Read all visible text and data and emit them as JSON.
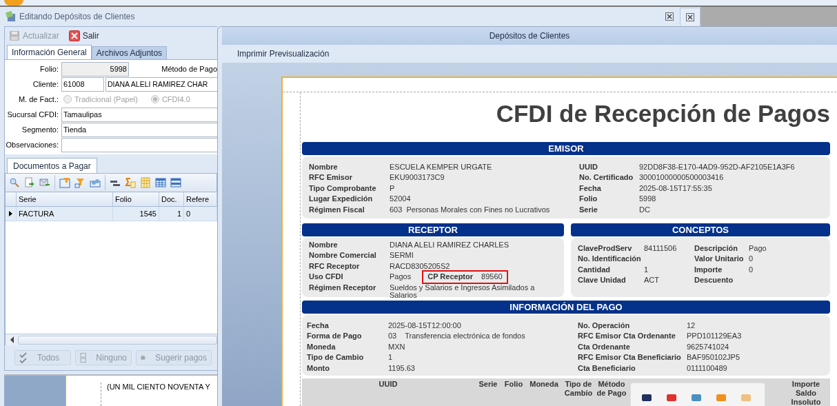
{
  "window": {
    "title": "Editando Depósitos de Clientes"
  },
  "toolbar": [
    {
      "label": "Actualizar",
      "disabled": true,
      "kind": "save"
    },
    {
      "label": "Salir",
      "disabled": false,
      "kind": "exit"
    }
  ],
  "tabs": [
    {
      "label": "Información General",
      "selected": true
    },
    {
      "label": "Archivos Adjuntos",
      "selected": false
    }
  ],
  "form": {
    "folio_label": "Folio:",
    "folio": "5998",
    "metodo_label": "Método de Pago",
    "cliente_label": "Cliente:",
    "cliente_code": "61008",
    "cliente_name": "DIANA ALELI RAMIREZ CHAR",
    "fact_label": "M. de Fact.:",
    "fact_options": [
      {
        "label": "Tradicional (Papel)",
        "selected": false,
        "disabled": true
      },
      {
        "label": "CFDI4.0",
        "selected": true,
        "disabled": true
      }
    ],
    "sucursal_label": "Sucursal CFDI:",
    "sucursal": "Tamaulipas",
    "segmento_label": "Segmento:",
    "segmento": "Tienda",
    "observaciones_label": "Observaciones:"
  },
  "documents": {
    "tab": "Documentos a Pagar",
    "columns": [
      "Serie",
      "Folio",
      "Doc.",
      "Refere"
    ],
    "rows": [
      {
        "selected": true,
        "cells": [
          "FACTURA",
          "1545",
          "1",
          "0"
        ]
      }
    ],
    "buttons": [
      {
        "label": "Todos",
        "disabled": true,
        "kind": "all"
      },
      {
        "label": "Ninguno",
        "disabled": true,
        "kind": "none"
      },
      {
        "label": "Sugerir pagos",
        "disabled": true,
        "kind": "suggest"
      }
    ]
  },
  "behind_text": "(UN MIL CIENTO NOVENTA Y",
  "preview": {
    "title": "Depósitos de Clientes",
    "menu": "Imprimir Previsualización",
    "report": {
      "heading": "CFDI de Recepción de Pagos",
      "emisor": {
        "title": "EMISOR",
        "left": [
          {
            "label": "Nombre",
            "value": "ESCUELA KEMPER URGATE"
          },
          {
            "label": "RFC Emisor",
            "value": "EKU9003173C9"
          },
          {
            "label": "Tipo Comprobante",
            "value": "P"
          },
          {
            "label": "Lugar Expedición",
            "value": "52004"
          },
          {
            "label": "Régimen Fiscal",
            "value": "603  Personas Morales con Fines no Lucrativos"
          }
        ],
        "right": [
          {
            "label": "UUID",
            "value": "92DD8F38-E170-4AD9-952D-AF2105E1A3F6"
          },
          {
            "label": "No. Certificado",
            "value": "30001000000500003416"
          },
          {
            "label": "Fecha",
            "value": "2025-08-15T17:55:35"
          },
          {
            "label": "Folio",
            "value": "5998"
          },
          {
            "label": "Serie",
            "value": "DC"
          }
        ]
      },
      "receptor": {
        "title": "RECEPTOR",
        "fields": [
          {
            "label": "Nombre",
            "value": "DIANA ALELI RAMIREZ CHARLES"
          },
          {
            "label": "Nombre Comercial",
            "value": "SERMI"
          },
          {
            "label": "RFC Receptor",
            "value": "RACD8305205S2"
          },
          {
            "label": "Uso CFDI",
            "value": "Pagos"
          },
          {
            "label": "Régimen Receptor",
            "value": "Sueldos y Salarios e Ingresos Asimilados a Salarios"
          }
        ],
        "cp_label": "CP Receptor",
        "cp_value": "89560",
        "highlighted": true
      },
      "conceptos": {
        "title": "CONCEPTOS",
        "left": [
          {
            "label": "ClaveProdServ",
            "value": "84111506"
          },
          {
            "label": "No. Identificación"
          },
          {
            "label": "Cantidad",
            "value": "1"
          },
          {
            "label": "Clave Unidad",
            "value": "ACT"
          }
        ],
        "right": [
          {
            "label": "Descripción",
            "value": "Pago"
          },
          {
            "label": "Valor Unitario",
            "value": "0"
          },
          {
            "label": "Importe",
            "value": "0"
          },
          {
            "label": "Descuento"
          }
        ]
      },
      "pago": {
        "title": "INFORMACIÓN DEL PAGO",
        "left": [
          {
            "label": "Fecha",
            "value": "2025-08-15T12:00:00"
          },
          {
            "label": "Forma de Pago",
            "value": "03    Transferencia electrónica de fondos"
          },
          {
            "label": "Moneda",
            "value": "MXN"
          },
          {
            "label": "Tipo de Cambio",
            "value": "1"
          },
          {
            "label": "Monto",
            "value": "1195.63"
          }
        ],
        "right": [
          {
            "label": "No. Operación",
            "value": "12"
          },
          {
            "label": "RFC Emisor Cta Ordenante",
            "value": "PPD101129EA3"
          },
          {
            "label": "Cta Ordenante",
            "value": "9625741024"
          },
          {
            "label": "RFC Emisor Cta Beneficiario",
            "value": "BAF950102JP5"
          },
          {
            "label": "Cta Beneficiario",
            "value": "0111100489"
          }
        ]
      },
      "table_columns": [
        "UUID",
        "Serie",
        "Folio",
        "Moneda",
        "Tipo de Cambio",
        "Método de Pago",
        "Importe Saldo Insoluto"
      ]
    }
  }
}
